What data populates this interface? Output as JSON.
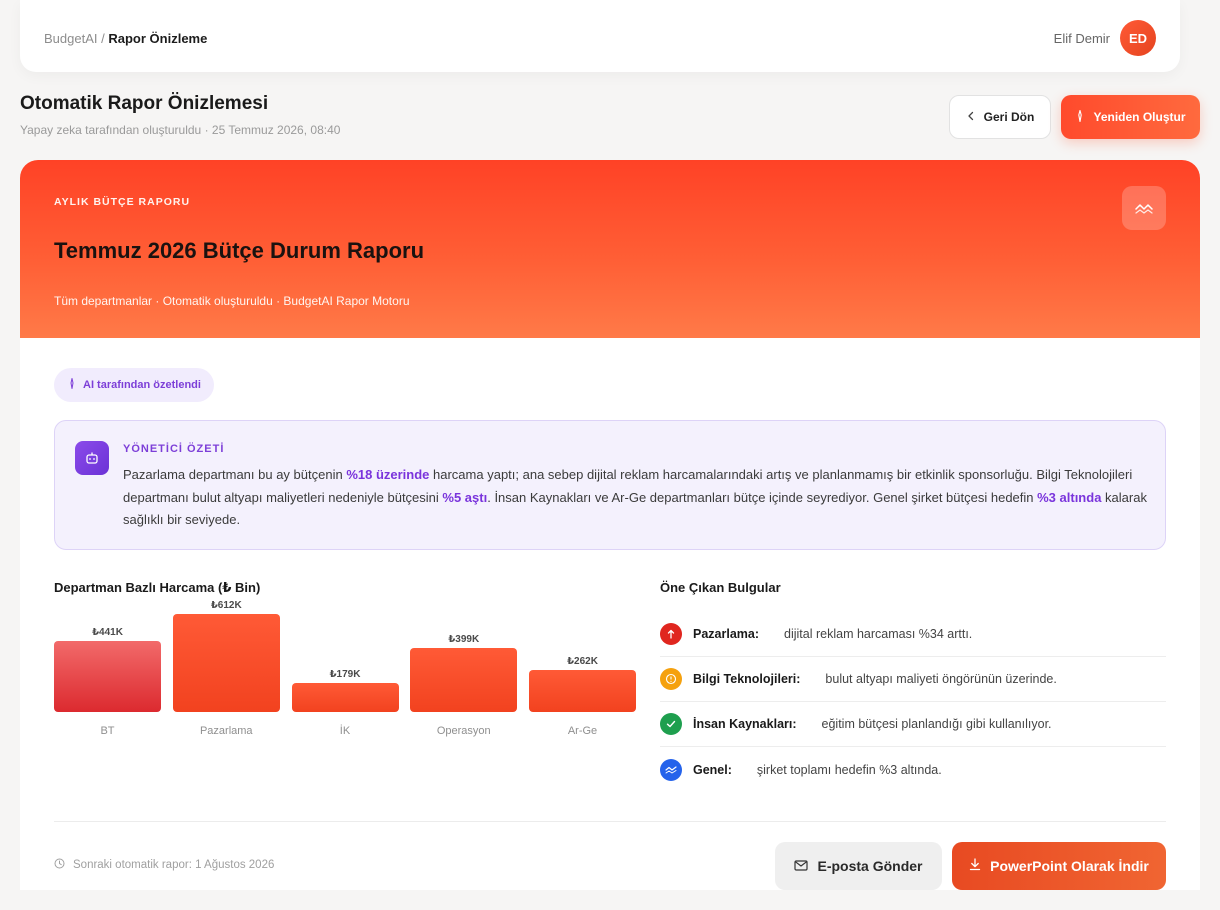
{
  "breadcrumb": {
    "root": "BudgetAI",
    "separator": "/",
    "current": "Rapor Önizleme"
  },
  "user": {
    "name": "Elif Demir",
    "initials": "ED"
  },
  "page": {
    "title": "Otomatik Rapor Önizlemesi",
    "subtitle": "Yapay zeka tarafından oluşturuldu · 25 Temmuz 2026, 08:40",
    "back_label": "Geri Dön",
    "regenerate_label": "Yeniden Oluştur"
  },
  "hero": {
    "eyebrow": "AYLIK BÜTÇE RAPORU",
    "title": "Temmuz 2026 Bütçe Durum Raporu",
    "subtitle": "Tüm departmanlar · Otomatik oluşturuldu · BudgetAI Rapor Motoru",
    "icon": "trend-icon"
  },
  "ai_badge": "AI tarafından özetlendi",
  "summary": {
    "title": "YÖNETİCİ ÖZETİ",
    "parts": [
      "Pazarlama departmanı bu ay bütçenin ",
      "%18 üzerinde",
      " harcama yaptı; ana sebep dijital reklam harcamalarındaki artış ve planlanmamış bir etkinlik sponsorluğu. Bilgi Teknolojileri departmanı bulut altyapı maliyetleri nedeniyle bütçesini ",
      "%5 aştı",
      ". İnsan Kaynakları ve Ar-Ge departmanları bütçe içinde seyrediyor. Genel şirket bütçesi hedefin ",
      "%3 altında",
      " kalarak sağlıklı bir seviyede."
    ]
  },
  "chart_data": {
    "type": "bar",
    "title": "Departman Bazlı Harcama (₺ Bin)",
    "categories": [
      "BT",
      "Pazarlama",
      "İK",
      "Operasyon",
      "Ar-Ge"
    ],
    "values": [
      441,
      612,
      179,
      399,
      262
    ],
    "value_labels": [
      "₺441K",
      "₺612K",
      "₺179K",
      "₺399K",
      "₺262K"
    ],
    "colors": [
      "#dc2a2f",
      "#f2421f",
      "#f2421f",
      "#f2421f",
      "#f2421f"
    ]
  },
  "findings": {
    "title": "Öne Çıkan Bulgular",
    "items": [
      {
        "label": "Pazarlama:",
        "text": "dijital reklam harcaması %34 arttı.",
        "icon": "arrow-up-icon",
        "color": "#e0261f"
      },
      {
        "label": "Bilgi Teknolojileri:",
        "text": "bulut altyapı maliyeti öngörünün üzerinde.",
        "icon": "warning-icon",
        "color": "#f5a10e"
      },
      {
        "label": "İnsan Kaynakları:",
        "text": "eğitim bütçesi planlandığı gibi kullanılıyor.",
        "icon": "check-icon",
        "color": "#1e9f4e"
      },
      {
        "label": "Genel:",
        "text": "şirket toplamı hedefin %3 altında.",
        "icon": "trend-icon",
        "color": "#2563eb"
      }
    ]
  },
  "footer": {
    "next_report": "Sonraki otomatik rapor: 1 Ağustos 2026",
    "email_label": "E-posta Gönder",
    "download_label": "PowerPoint Olarak İndir"
  }
}
